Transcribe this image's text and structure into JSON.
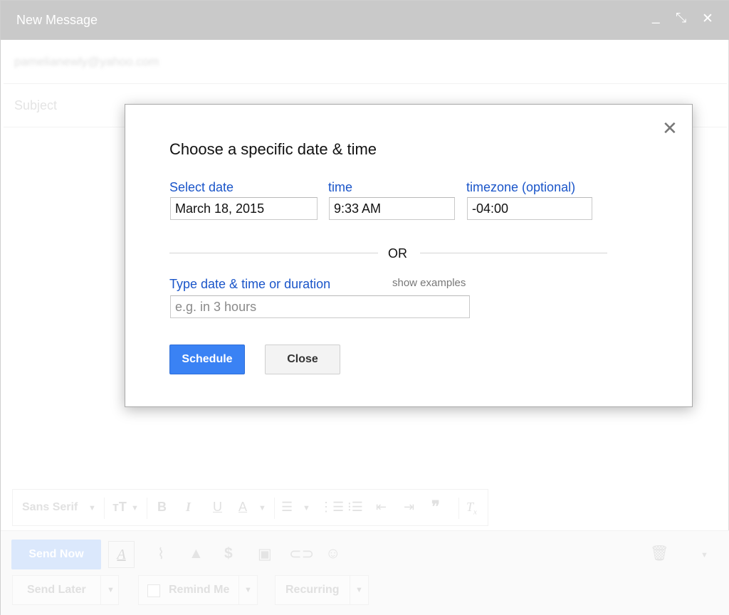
{
  "window": {
    "title": "New Message",
    "minimize_glyph": "_",
    "popout_glyph": "⤡",
    "close_glyph": "✕"
  },
  "fields": {
    "to_value": "pamelianewly@yahoo.com",
    "subject_placeholder": "Subject"
  },
  "formatting": {
    "font_label": "Sans Serif",
    "icons": [
      "text-size-icon",
      "bold-icon",
      "italic-icon",
      "underline-icon",
      "text-color-icon",
      "align-icon",
      "numbered-list-icon",
      "bulleted-list-icon",
      "indent-less-icon",
      "indent-more-icon",
      "quote-icon",
      "remove-formatting-icon"
    ]
  },
  "bottom_bar": {
    "send_now_label": "Send Now",
    "send_later_label": "Send Later",
    "remind_me_label": "Remind Me",
    "recurring_label": "Recurring",
    "icons": [
      "formatting-icon",
      "attach-icon",
      "drive-icon",
      "dollar-icon",
      "image-icon",
      "link-icon",
      "emoji-icon",
      "trash-icon",
      "more-options-icon"
    ]
  },
  "dialog": {
    "title": "Choose a specific date & time",
    "select_date_label": "Select date",
    "time_label": "time",
    "timezone_label": "timezone (optional)",
    "date_value": "March 18, 2015",
    "time_value": "9:33 AM",
    "timezone_value": "-04:00",
    "or_label": "OR",
    "type_label": "Type date & time or duration",
    "show_examples_label": "show examples",
    "type_placeholder": "e.g. in 3 hours",
    "schedule_label": "Schedule",
    "close_label": "Close",
    "close_glyph": "✕"
  },
  "colors": {
    "titlebar": "#c9c9c9",
    "link_blue": "#1a55c9",
    "primary_button": "#3a82f4"
  }
}
